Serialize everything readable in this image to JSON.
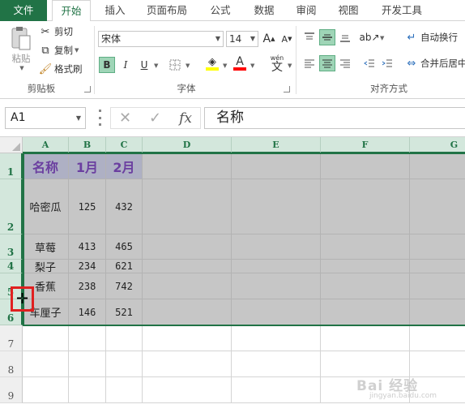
{
  "tabs": [
    "文件",
    "开始",
    "插入",
    "页面布局",
    "公式",
    "数据",
    "审阅",
    "视图",
    "开发工具"
  ],
  "active_tab": "开始",
  "clipboard": {
    "paste_label": "粘贴",
    "cut_label": "剪切",
    "copy_label": "复制",
    "format_painter_label": "格式刷",
    "group_label": "剪贴板"
  },
  "font": {
    "font_name": "宋体",
    "font_size": "14",
    "bold": "B",
    "italic": "I",
    "underline": "U",
    "increase_size": "A",
    "decrease_size": "A",
    "font_color_glyph": "A",
    "phonetic_label": "wén",
    "phonetic_glyph": "文",
    "group_label": "字体",
    "fill_color": "#ffff00",
    "font_color": "#ff0000"
  },
  "alignment": {
    "wrap_text_label": "自动换行",
    "merge_center_label": "合并后居中",
    "group_label": "对齐方式"
  },
  "formula_bar": {
    "name_box": "A1",
    "cancel_glyph": "✕",
    "enter_glyph": "✓",
    "fx_label": "fx",
    "formula_value": "名称"
  },
  "columns": [
    "A",
    "B",
    "C",
    "D",
    "E",
    "F",
    "G"
  ],
  "rows": [
    "1",
    "2",
    "3",
    "4",
    "5",
    "6",
    "7",
    "8",
    "9"
  ],
  "table": {
    "header": [
      "名称",
      "1月",
      "2月"
    ],
    "rows": [
      [
        "哈密瓜",
        "125",
        "432"
      ],
      [
        "草莓",
        "413",
        "465"
      ],
      [
        "梨子",
        "234",
        "621"
      ],
      [
        "香蕉",
        "238",
        "742"
      ],
      [
        "车厘子",
        "146",
        "521"
      ]
    ]
  },
  "resize_cursor_glyph": "✛",
  "watermark": {
    "text": "Bai 经验",
    "sub": "jingyan.baidu.com"
  },
  "colors": {
    "excel_green": "#217346",
    "header_highlight": "#d3e7dc",
    "selection_fill": "#c6c6c6",
    "header_row_fill": "#aeb0c4",
    "header_text": "#6b3fa0",
    "cursor_box": "#e02020"
  }
}
